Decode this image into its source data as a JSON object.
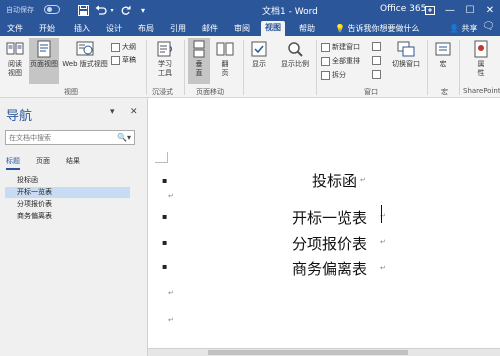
{
  "titlebar": {
    "autosave_label": "自动保存",
    "document_title": "文档1 - Word",
    "account": "Office 365"
  },
  "tabs": [
    "文件",
    "开始",
    "插入",
    "设计",
    "布局",
    "引用",
    "邮件",
    "审阅",
    "视图",
    "帮助"
  ],
  "active_tab": "视图",
  "tell_me": "告诉我你想要做什么",
  "share_label": "共享",
  "ribbon": {
    "read_mode": "阅读\n视图",
    "print_layout": "页面视图",
    "web_layout": "Web 版式视图",
    "outline": "大纲",
    "draft": "草稿",
    "group_views": "视图",
    "learning_tools": "学习\n工具",
    "group_immersive": "沉浸式",
    "vertical": "垂\n直",
    "side_to_side": "翻\n页",
    "group_page_movement": "页面移动",
    "show": "显示",
    "zoom": "显示比例",
    "new_window": "新建窗口",
    "arrange_all": "全部重排",
    "split": "拆分",
    "switch_windows": "切换窗口",
    "group_window": "窗口",
    "macros": "宏",
    "group_macros": "宏",
    "properties": "属\n性",
    "group_sharepoint": "SharePoint"
  },
  "nav": {
    "title": "导航",
    "search_placeholder": "在文档中搜索",
    "tabs": [
      "标题",
      "页面",
      "结果"
    ],
    "items": [
      "投标函",
      "开标一览表",
      "分项报价表",
      "商务偏离表"
    ],
    "selected_index": 1
  },
  "document": {
    "lines": [
      "投标函",
      "开标一览表",
      "分项报价表",
      "商务偏离表"
    ],
    "para_mark": "↵"
  }
}
